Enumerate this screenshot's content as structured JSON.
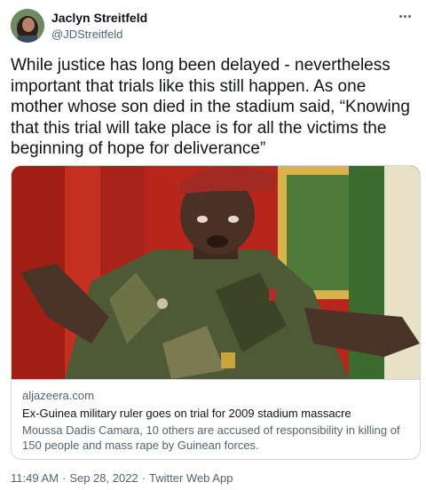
{
  "author": {
    "name": "Jaclyn Streitfeld",
    "handle": "@JDStreitfeld"
  },
  "tweet": {
    "text": "While justice has long been delayed - nevertheless important that trials like this still happen. As one mother whose son died in the stadium said, “Knowing that this trial will take place is for all the victims the beginning of hope for deliverance”"
  },
  "card": {
    "domain": "aljazeera.com",
    "title": "Ex-Guinea military ruler goes on trial for 2009 stadium massacre",
    "description": "Moussa Dadis Camara, 10 others are accused of responsibility in killing of 150 people and mass rape by Guinean forces."
  },
  "meta": {
    "time": "11:49 AM",
    "separator1": "·",
    "date": "Sep 28, 2022",
    "separator2": "·",
    "source": "Twitter Web App"
  },
  "icons": {
    "more": "more-horizontal-icon"
  }
}
